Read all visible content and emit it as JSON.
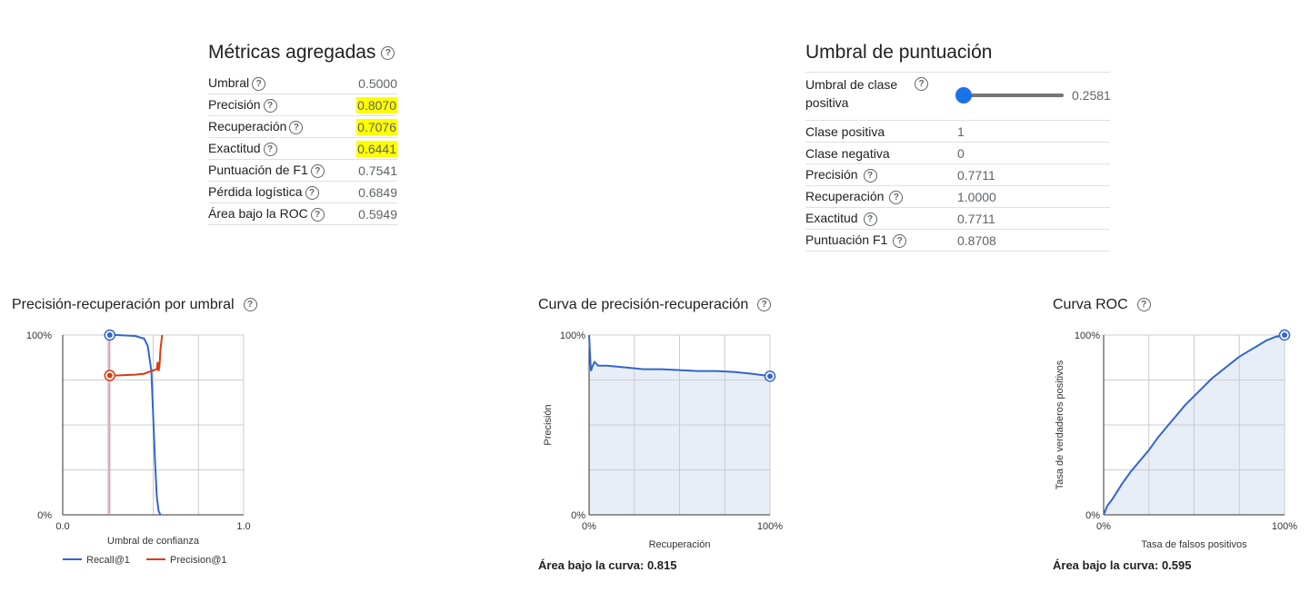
{
  "aggregate": {
    "title": "Métricas agregadas",
    "rows": [
      {
        "label": "Umbral",
        "value": "0.5000",
        "highlight": false
      },
      {
        "label": "Precisión",
        "value": "0.8070",
        "highlight": true
      },
      {
        "label": "Recuperación",
        "value": "0.7076",
        "highlight": true
      },
      {
        "label": "Exactitud",
        "value": "0.6441",
        "highlight": true
      },
      {
        "label": "Puntuación de F1",
        "value": "0.7541",
        "highlight": false
      },
      {
        "label": "Pérdida logística",
        "value": "0.6849",
        "highlight": false
      },
      {
        "label": "Área bajo la ROC",
        "value": "0.5949",
        "highlight": false
      }
    ]
  },
  "threshold": {
    "title": "Umbral de puntuación",
    "slider_label": "Umbral de clase positiva",
    "slider_value": "0.2581",
    "slider_fraction": 0.2581,
    "rows": [
      {
        "label": "Clase positiva",
        "value": "1"
      },
      {
        "label": "Clase negativa",
        "value": "0"
      },
      {
        "label": "Precisión",
        "value": "0.7711"
      },
      {
        "label": "Recuperación",
        "value": "1.0000"
      },
      {
        "label": "Exactitud",
        "value": "0.7711"
      },
      {
        "label": "Puntuación F1",
        "value": "0.8708"
      }
    ]
  },
  "charts": {
    "pr_threshold": {
      "title": "Precisión-recuperación por umbral",
      "xlabel": "Umbral de confianza",
      "y_top": "100%",
      "y_bottom": "0%",
      "x_left": "0.0",
      "x_right": "1.0",
      "legend": [
        "Recall@1",
        "Precision@1"
      ]
    },
    "pr_curve": {
      "title": "Curva de precisión-recuperación",
      "xlabel": "Recuperación",
      "ylabel": "Precisión",
      "y_top": "100%",
      "y_bottom": "0%",
      "x_left": "0%",
      "x_right": "100%",
      "auc": "Área bajo la curva: 0.815"
    },
    "roc": {
      "title": "Curva ROC",
      "xlabel": "Tasa de falsos positivos",
      "ylabel": "Tasa de verdaderos positivos",
      "y_top": "100%",
      "y_bottom": "0%",
      "x_left": "0%",
      "x_right": "100%",
      "auc": "Área bajo la curva: 0.595"
    }
  },
  "colors": {
    "recall": "#3366cc",
    "precision": "#dc3912",
    "accent": "#1a73e8",
    "threshold_line": "#d9a6a8",
    "area_fill": "#e8eef8",
    "highlight": "#ffff00"
  },
  "chart_data": [
    {
      "type": "line",
      "title": "Precisión-recuperación por umbral",
      "xlabel": "Umbral de confianza",
      "xlim": [
        0,
        1
      ],
      "ylim": [
        0,
        1
      ],
      "selected_threshold": 0.2581,
      "series": [
        {
          "name": "Recall@1",
          "x": [
            0.26,
            0.3,
            0.4,
            0.45,
            0.47,
            0.49,
            0.5,
            0.51,
            0.52,
            0.53,
            0.54
          ],
          "y": [
            1.0,
            1.0,
            0.995,
            0.98,
            0.94,
            0.8,
            0.55,
            0.3,
            0.1,
            0.02,
            0.0
          ]
        },
        {
          "name": "Precision@1",
          "x": [
            0.26,
            0.3,
            0.4,
            0.45,
            0.49,
            0.52,
            0.525,
            0.53,
            0.535,
            0.54,
            0.55
          ],
          "y": [
            0.775,
            0.775,
            0.78,
            0.785,
            0.8,
            0.81,
            0.85,
            0.8,
            0.83,
            0.92,
            1.0
          ]
        }
      ]
    },
    {
      "type": "area",
      "title": "Curva de precisión-recuperación",
      "xlabel": "Recuperación",
      "ylabel": "Precisión",
      "xlim": [
        0,
        1
      ],
      "ylim": [
        0,
        1
      ],
      "area_under_curve": 0.815,
      "series": [
        {
          "x": [
            0.0,
            0.01,
            0.02,
            0.03,
            0.05,
            0.1,
            0.2,
            0.3,
            0.4,
            0.5,
            0.6,
            0.7,
            0.8,
            0.9,
            1.0
          ],
          "y": [
            1.0,
            0.8,
            0.83,
            0.85,
            0.83,
            0.83,
            0.82,
            0.81,
            0.81,
            0.805,
            0.8,
            0.8,
            0.795,
            0.785,
            0.771
          ]
        }
      ]
    },
    {
      "type": "area",
      "title": "Curva ROC",
      "xlabel": "Tasa de falsos positivos",
      "ylabel": "Tasa de verdaderos positivos",
      "xlim": [
        0,
        1
      ],
      "ylim": [
        0,
        1
      ],
      "area_under_curve": 0.595,
      "series": [
        {
          "x": [
            0.0,
            0.02,
            0.05,
            0.1,
            0.15,
            0.2,
            0.25,
            0.3,
            0.35,
            0.4,
            0.45,
            0.5,
            0.55,
            0.6,
            0.65,
            0.7,
            0.75,
            0.8,
            0.85,
            0.9,
            0.95,
            1.0
          ],
          "y": [
            0.0,
            0.05,
            0.09,
            0.17,
            0.24,
            0.3,
            0.36,
            0.43,
            0.49,
            0.55,
            0.61,
            0.66,
            0.71,
            0.76,
            0.8,
            0.84,
            0.88,
            0.91,
            0.94,
            0.97,
            0.99,
            1.0
          ]
        }
      ]
    }
  ]
}
